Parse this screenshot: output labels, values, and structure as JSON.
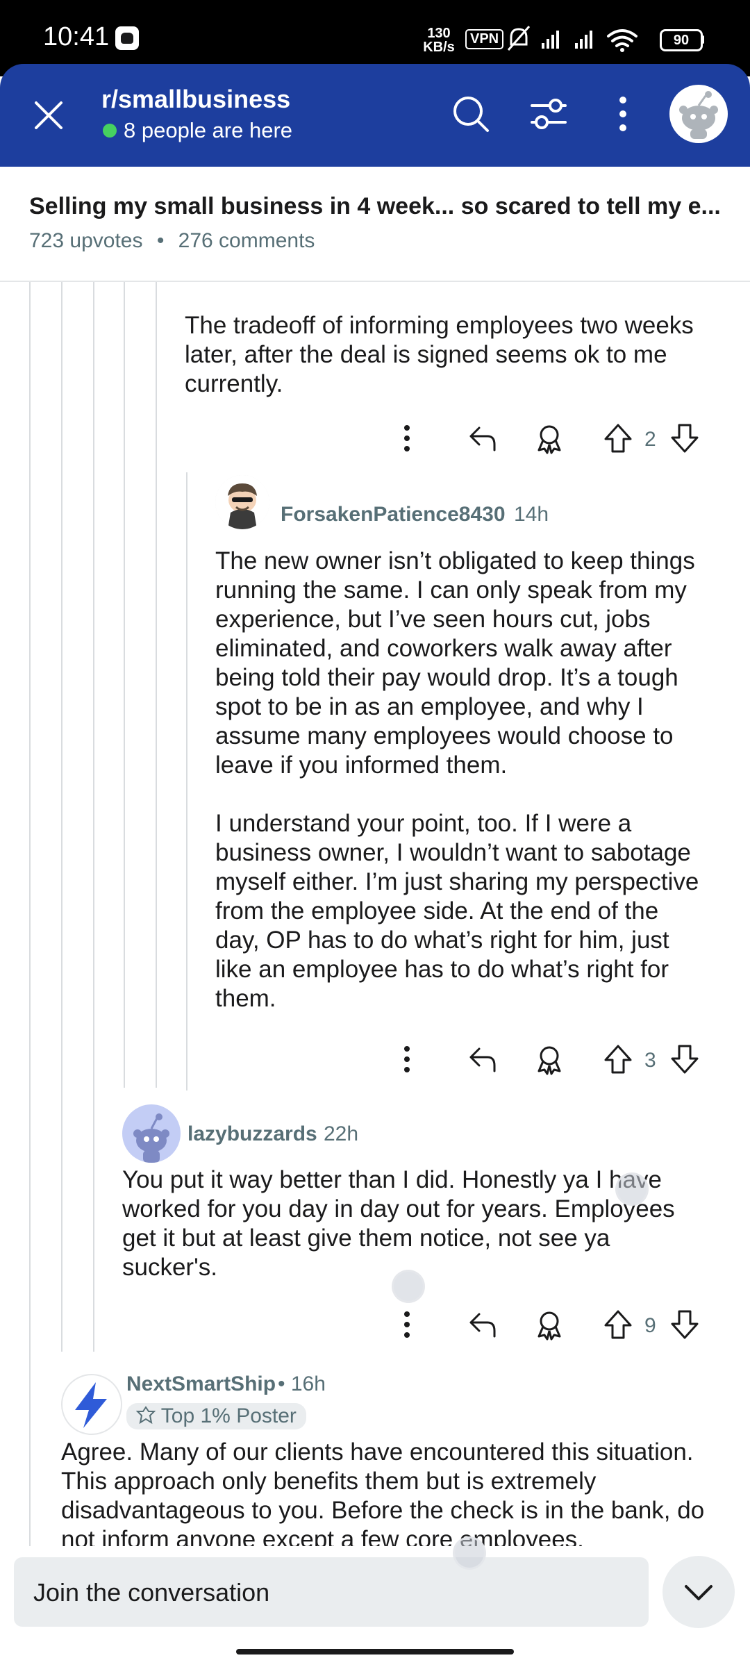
{
  "status_bar": {
    "time": "10:41",
    "speed_value": "130",
    "speed_unit": "KB/s",
    "vpn": "VPN",
    "battery": "90"
  },
  "header": {
    "subreddit": "r/smallbusiness",
    "online": "8 people are here"
  },
  "post": {
    "title": "Selling my small business in 4 week... so scared to tell my e...",
    "upvotes": "723 upvotes",
    "separator": "•",
    "comments": "276 comments"
  },
  "comments": [
    {
      "text_lines": [
        "The tradeoff of informing employees two weeks",
        "later, after the deal is signed seems ok to me",
        "currently."
      ],
      "votes": "2"
    },
    {
      "author": "ForsakenPatience8430",
      "time": "14h",
      "text_lines": [
        "The new owner isn’t obligated to keep things",
        "running the same. I can only speak from my",
        "experience, but I’ve seen hours cut, jobs",
        "eliminated, and coworkers walk away after",
        "being told their pay would drop. It’s a tough",
        "spot to be in as an employee, and why I",
        "assume many employees would choose to",
        "leave if you informed them."
      ],
      "text_lines_2": [
        "I understand your point, too. If I were a",
        "business owner, I wouldn’t want to sabotage",
        "myself either. I’m just sharing my perspective",
        "from the employee side. At the end of the",
        "day, OP has to do what’s right for him, just",
        "like an employee has to do what’s right for",
        "them."
      ],
      "votes": "3"
    },
    {
      "author": "lazybuzzards",
      "time": "22h",
      "text_lines": [
        "You put it way better than I did. Honestly ya I have",
        "worked for you day in day out for years. Employees",
        "get it but at least give them notice, not see ya",
        "sucker's."
      ],
      "votes": "9"
    },
    {
      "author": "NextSmartShip",
      "separator": "•",
      "time": "16h",
      "flair": "Top 1% Poster",
      "text_lines": [
        "Agree. Many of our clients have encountered this situation.",
        "This approach only benefits them but is extremely",
        "disadvantageous to you. Before the check is in the bank, do",
        "not inform anyone except a few core employees."
      ]
    }
  ],
  "footer": {
    "join_placeholder": "Join the conversation"
  },
  "colors": {
    "header_bg": "#1d3e9e",
    "online_dot": "#46d160",
    "text": "#1a1a1b",
    "meta": "#576f76"
  }
}
